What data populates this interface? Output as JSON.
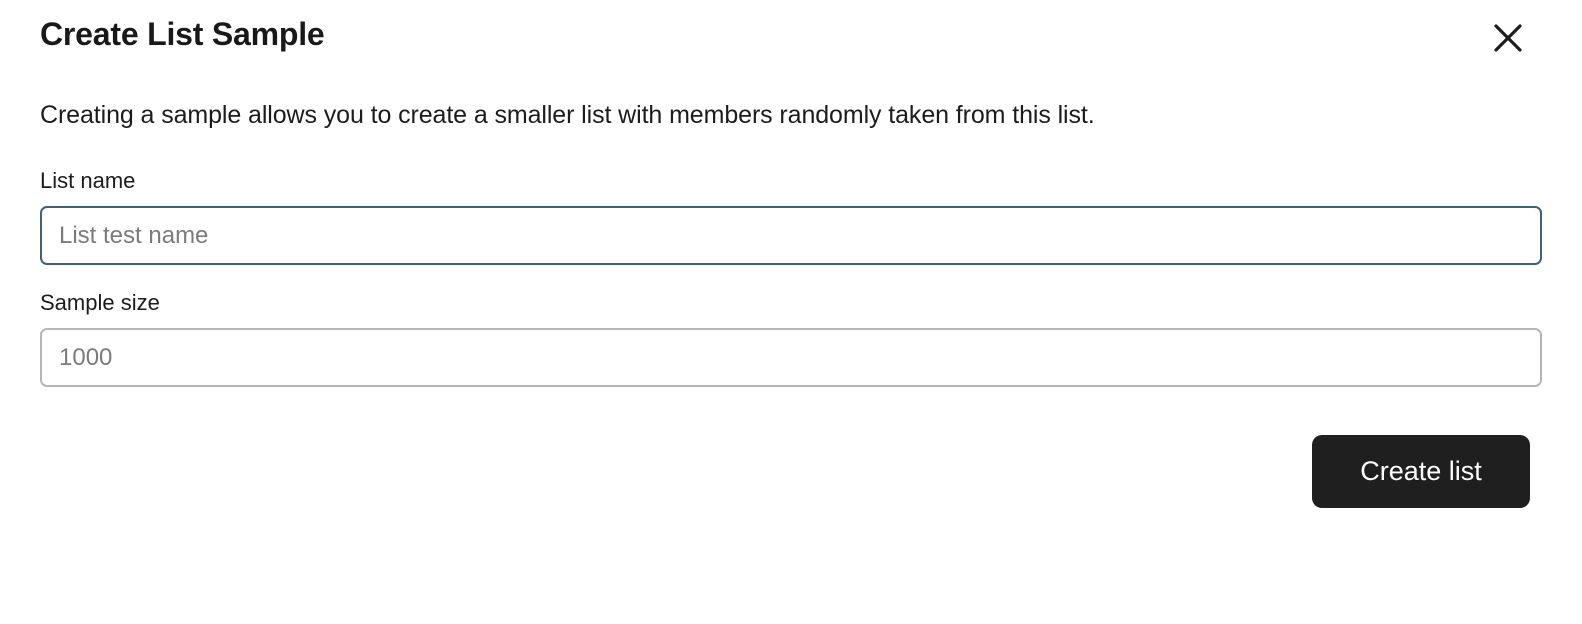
{
  "dialog": {
    "title": "Create List Sample",
    "description": "Creating a sample allows you to create a smaller list with members randomly taken from this list.",
    "close_icon": "close-x-icon"
  },
  "form": {
    "fields": [
      {
        "label": "List name",
        "value": "",
        "placeholder": "List test name",
        "focused": true
      },
      {
        "label": "Sample size",
        "value": "",
        "placeholder": "1000",
        "focused": false
      }
    ]
  },
  "footer": {
    "submit_label": "Create list"
  },
  "colors": {
    "background": "#ffffff",
    "text": "#1c1c1c",
    "title": "#191919",
    "placeholder": "#7b7b7b",
    "input_border": "#b5b5b5",
    "input_border_focused": "#41607c",
    "button_background": "#1f1f1f",
    "button_text": "#ffffff"
  }
}
